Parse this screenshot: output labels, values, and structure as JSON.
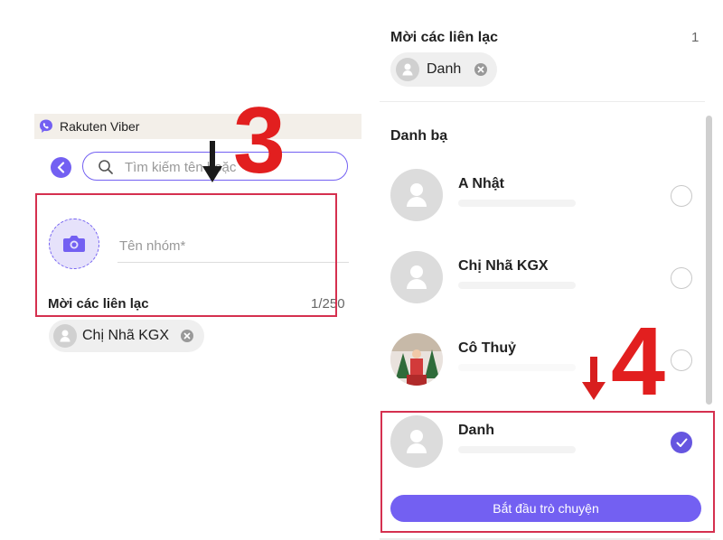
{
  "left_panel": {
    "app_title": "Rakuten Viber",
    "search_placeholder": "Tìm kiếm tên hoặc",
    "group_name_placeholder": "Tên nhóm*",
    "invite_label": "Mời các liên lạc",
    "invite_count": "1/250",
    "selected_chip": "Chị Nhã KGX"
  },
  "right_panel": {
    "invite_label": "Mời các liên lạc",
    "invite_count": "1",
    "selected_chip": "Danh",
    "section_label": "Danh bạ",
    "contacts": [
      {
        "name": "A Nhật",
        "selected": false
      },
      {
        "name": "Chị Nhã KGX",
        "selected": false
      },
      {
        "name": "Cô Thuỷ",
        "selected": false
      },
      {
        "name": "Danh",
        "selected": true
      }
    ],
    "start_button": "Bắt đầu trò chuyện"
  },
  "annotations": {
    "step_a": "3",
    "step_b": "4",
    "annotation_color": "#e21f1f"
  },
  "colors": {
    "accent": "#7360f2",
    "highlight_box": "#d5304f"
  }
}
